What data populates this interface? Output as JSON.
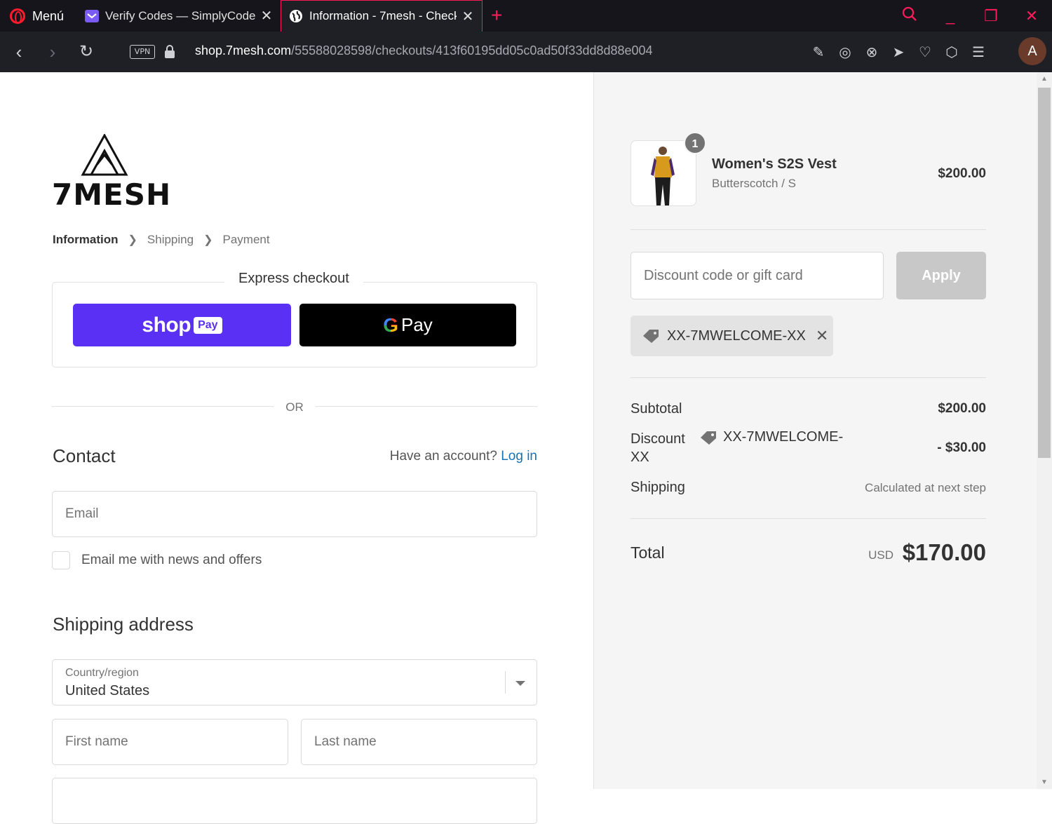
{
  "browser": {
    "menu_label": "Menú",
    "tabs": [
      {
        "title": "Verify Codes — SimplyCodes"
      },
      {
        "title": "Information - 7mesh - Checkout"
      }
    ],
    "vpn_label": "VPN",
    "url_host": "shop.7mesh.com",
    "url_path": "/55588028598/checkouts/413f60195dd05c0ad50f33dd8d88e004",
    "avatar_initial": "A",
    "accent_color": "#ff1b5a"
  },
  "brand": {
    "name": "7MESH"
  },
  "breadcrumb": {
    "items": [
      "Information",
      "Shipping",
      "Payment"
    ]
  },
  "express": {
    "title": "Express checkout",
    "shop_label": "shop",
    "shop_pay_label": "Pay",
    "gpay_g": "G",
    "gpay_label": "Pay",
    "or_label": "OR"
  },
  "contact": {
    "heading": "Contact",
    "have_account": "Have an account?",
    "login_label": "Log in",
    "email_placeholder": "Email",
    "newsletter_label": "Email me with news and offers"
  },
  "shipping_address": {
    "heading": "Shipping address",
    "country_label": "Country/region",
    "country_value": "United States",
    "first_name_placeholder": "First name",
    "last_name_placeholder": "Last name"
  },
  "order": {
    "item": {
      "name": "Women's S2S Vest",
      "variant": "Butterscotch / S",
      "price": "$200.00",
      "quantity": "1"
    },
    "discount_placeholder": "Discount code or gift card",
    "apply_label": "Apply",
    "applied_code": "XX-7MWELCOME-XX",
    "subtotal_label": "Subtotal",
    "subtotal_value": "$200.00",
    "discount_label": "Discount",
    "discount_code_line1": "XX-7MWELCOME-",
    "discount_code_line2": "XX",
    "discount_value": "- $30.00",
    "shipping_label": "Shipping",
    "shipping_value": "Calculated at next step",
    "total_label": "Total",
    "total_currency": "USD",
    "total_value": "$170.00"
  },
  "colors": {
    "shop_pay": "#5a31f4",
    "link": "#1773b0",
    "product_jacket": "#d89a1c",
    "product_sleeve": "#4b2a6e"
  }
}
